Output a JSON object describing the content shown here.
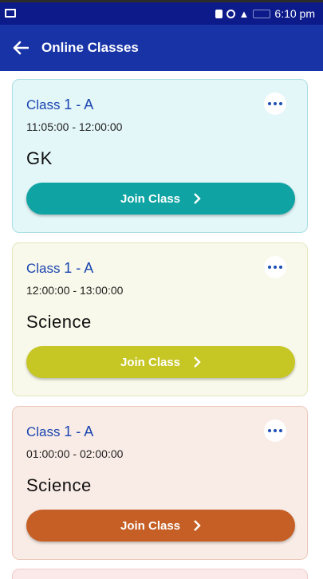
{
  "status_bar": {
    "time": "6:10 pm"
  },
  "header": {
    "title": "Online Classes",
    "back_icon": "arrow-left-icon"
  },
  "colors": {
    "status_bar": "#0d1a8a",
    "app_bar": "#1733a6",
    "class_text": "#1a44b0"
  },
  "classes": [
    {
      "class_label": "Class",
      "class_value": "1 - A",
      "time": "11:05:00 - 12:00:00",
      "subject": "GK",
      "button_label": "Join Class",
      "card_bg": "#e3f6f8",
      "card_border": "#a8dfe5",
      "button_color": "#0fa3a3"
    },
    {
      "class_label": "Class",
      "class_value": "1 - A",
      "time": "12:00:00 - 13:00:00",
      "subject": "Science",
      "button_label": "Join Class",
      "card_bg": "#f8f9ea",
      "card_border": "#e4e6c0",
      "button_color": "#c6c624"
    },
    {
      "class_label": "Class",
      "class_value": "1 - A",
      "time": "01:00:00 - 02:00:00",
      "subject": "Science",
      "button_label": "Join Class",
      "card_bg": "#f9ece6",
      "card_border": "#ebc7b8",
      "button_color": "#c55f25"
    }
  ]
}
